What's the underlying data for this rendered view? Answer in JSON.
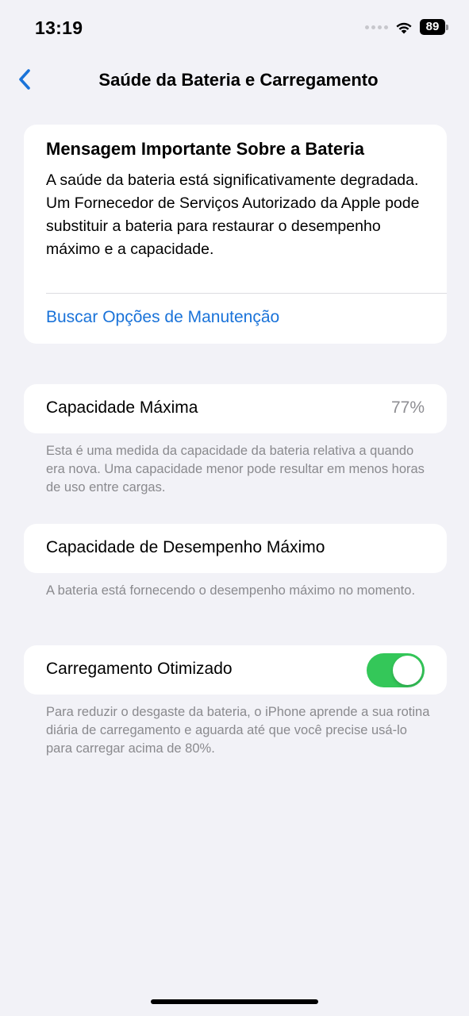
{
  "status_bar": {
    "time": "13:19",
    "battery_level": "89"
  },
  "nav": {
    "back_icon": "chevron-left-icon",
    "title": "Saúde da Bateria e Carregamento",
    "accent_color": "#1a73d9"
  },
  "message_card": {
    "title": "Mensagem Importante Sobre a Bateria",
    "body": "A saúde da bateria está significativamente degradada. Um Fornecedor de Serviços Autorizado da Apple pode substituir a bateria para restaurar o desempenho máximo e a capacidade.",
    "link_label": "Buscar Opções de Manutenção"
  },
  "max_capacity": {
    "label": "Capacidade Máxima",
    "value": "77%",
    "footnote": "Esta é uma medida da capacidade da bateria relativa a quando era nova. Uma capacidade menor pode resultar em menos horas de uso entre cargas."
  },
  "peak_performance": {
    "label": "Capacidade de Desempenho Máximo",
    "footnote": "A bateria está fornecendo o desempenho máximo no momento."
  },
  "optimized_charging": {
    "label": "Carregamento Otimizado",
    "enabled": true,
    "toggle_color": "#34c759",
    "footnote": "Para reduzir o desgaste da bateria, o iPhone aprende a sua rotina diária de carregamento e aguarda até que você precise usá-lo para carregar acima de 80%."
  }
}
